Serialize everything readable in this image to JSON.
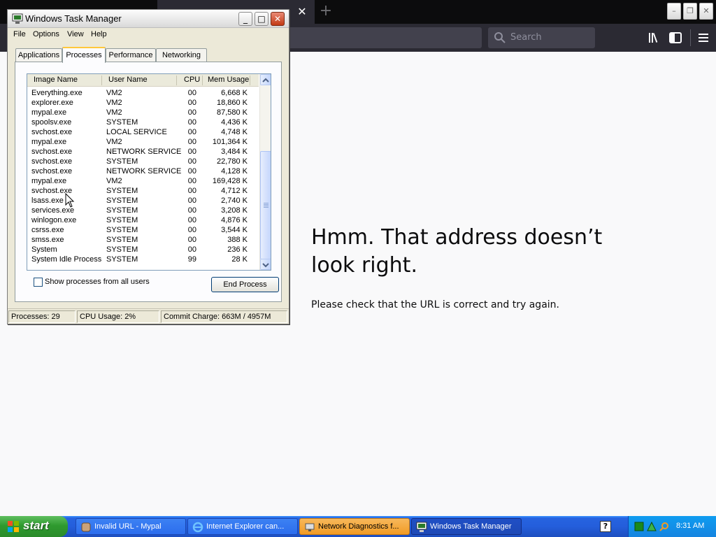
{
  "browser": {
    "search_placeholder": "Search",
    "error_title": "Hmm. That address doesn’t look right.",
    "error_description": "Please check that the URL is correct and try again."
  },
  "task_manager": {
    "title": "Windows Task Manager",
    "menu": [
      "File",
      "Options",
      "View",
      "Help"
    ],
    "tabs": [
      "Applications",
      "Processes",
      "Performance",
      "Networking"
    ],
    "active_tab": "Processes",
    "columns": [
      "Image Name",
      "User Name",
      "CPU",
      "Mem Usage"
    ],
    "processes": [
      {
        "name": "Everything.exe",
        "user": "VM2",
        "cpu": "00",
        "mem": "6,668 K"
      },
      {
        "name": "explorer.exe",
        "user": "VM2",
        "cpu": "00",
        "mem": "18,860 K"
      },
      {
        "name": "mypal.exe",
        "user": "VM2",
        "cpu": "00",
        "mem": "87,580 K"
      },
      {
        "name": "spoolsv.exe",
        "user": "SYSTEM",
        "cpu": "00",
        "mem": "4,436 K"
      },
      {
        "name": "svchost.exe",
        "user": "LOCAL SERVICE",
        "cpu": "00",
        "mem": "4,748 K"
      },
      {
        "name": "mypal.exe",
        "user": "VM2",
        "cpu": "00",
        "mem": "101,364 K"
      },
      {
        "name": "svchost.exe",
        "user": "NETWORK SERVICE",
        "cpu": "00",
        "mem": "3,484 K"
      },
      {
        "name": "svchost.exe",
        "user": "SYSTEM",
        "cpu": "00",
        "mem": "22,780 K"
      },
      {
        "name": "svchost.exe",
        "user": "NETWORK SERVICE",
        "cpu": "00",
        "mem": "4,128 K"
      },
      {
        "name": "mypal.exe",
        "user": "VM2",
        "cpu": "00",
        "mem": "169,428 K"
      },
      {
        "name": "svchost.exe",
        "user": "SYSTEM",
        "cpu": "00",
        "mem": "4,712 K"
      },
      {
        "name": "lsass.exe",
        "user": "SYSTEM",
        "cpu": "00",
        "mem": "2,740 K"
      },
      {
        "name": "services.exe",
        "user": "SYSTEM",
        "cpu": "00",
        "mem": "3,208 K"
      },
      {
        "name": "winlogon.exe",
        "user": "SYSTEM",
        "cpu": "00",
        "mem": "4,876 K"
      },
      {
        "name": "csrss.exe",
        "user": "SYSTEM",
        "cpu": "00",
        "mem": "3,544 K"
      },
      {
        "name": "smss.exe",
        "user": "SYSTEM",
        "cpu": "00",
        "mem": "388 K"
      },
      {
        "name": "System",
        "user": "SYSTEM",
        "cpu": "00",
        "mem": "236 K"
      },
      {
        "name": "System Idle Process",
        "user": "SYSTEM",
        "cpu": "99",
        "mem": "28 K"
      }
    ],
    "show_all_label": "Show processes from all users",
    "show_all_checked": false,
    "end_process_label": "End Process",
    "status": {
      "processes": "Processes: 29",
      "cpu_usage": "CPU Usage: 2%",
      "commit_charge": "Commit Charge: 663M / 4957M"
    }
  },
  "taskbar": {
    "start_label": "start",
    "tasks": [
      {
        "label": "Invalid URL - Mypal",
        "icon": "mypal-icon",
        "state": "normal"
      },
      {
        "label": "Internet Explorer can...",
        "icon": "internet-explorer-icon",
        "state": "normal"
      },
      {
        "label": "Network Diagnostics f...",
        "icon": "network-diagnostics-icon",
        "state": "flashing"
      },
      {
        "label": "Windows Task Manager",
        "icon": "task-manager-icon",
        "state": "active"
      }
    ],
    "clock": "8:31 AM"
  },
  "colors": {
    "browser_dark": "#2b2a33",
    "xp_taskbar_blue": "#245edb",
    "xp_start_green": "#2f9a2f",
    "flash_orange": "#f19b25"
  }
}
